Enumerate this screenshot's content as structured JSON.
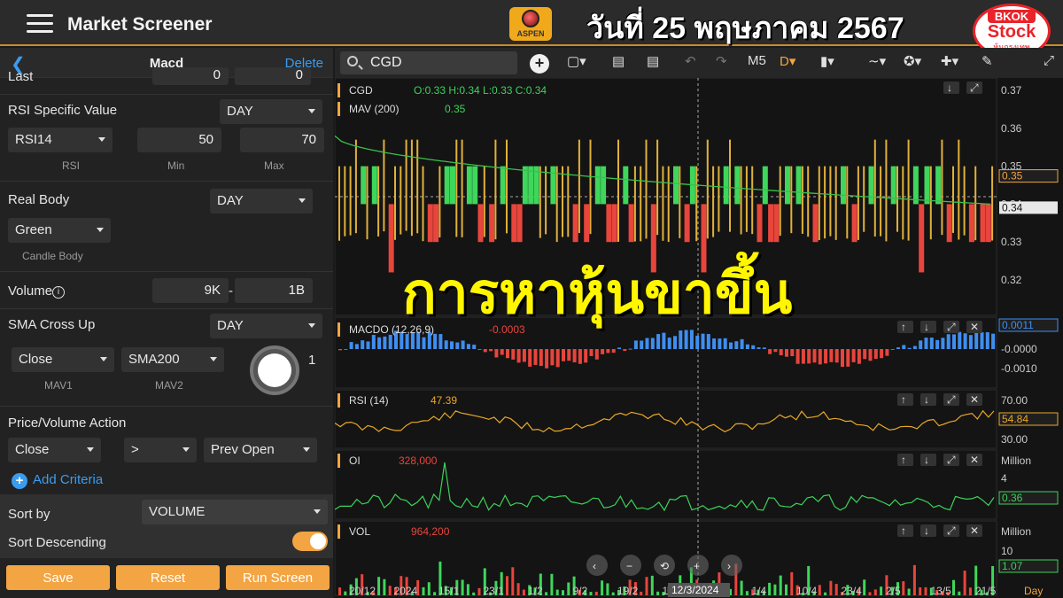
{
  "header": {
    "app_title": "Market Screener",
    "logo_text": "ASPEN",
    "date_banner": "วันที่ 25 พฤษภาคม 2567",
    "badge": {
      "line1": "BKOK",
      "line2": "Stock",
      "line3": "หุ้นกรุงเทพ"
    }
  },
  "panel": {
    "title": "Macd",
    "delete_label": "Delete",
    "last_label": "Last",
    "last_min": "0",
    "last_max": "0",
    "rsi": {
      "label": "RSI Specific Value",
      "period": "DAY",
      "indicator": "RSI14",
      "min": "50",
      "max": "70",
      "sub_rsi": "RSI",
      "sub_min": "Min",
      "sub_max": "Max"
    },
    "real_body": {
      "label": "Real Body",
      "period": "DAY",
      "value": "Green",
      "sub": "Candle Body"
    },
    "volume": {
      "label": "Volume",
      "min": "9K",
      "sep": "-",
      "max": "1B"
    },
    "sma": {
      "label": "SMA Cross Up",
      "period": "DAY",
      "mav1": "Close",
      "mav2": "SMA200",
      "extra": "1",
      "sub_mav1": "MAV1",
      "sub_mav2": "MAV2"
    },
    "pva": {
      "label": "Price/Volume Action",
      "field": "Close",
      "op": ">",
      "target": "Prev Open"
    },
    "add_criteria": "Add Criteria",
    "sort_by_label": "Sort by",
    "sort_by_value": "VOLUME",
    "sort_desc_label": "Sort Descending",
    "buttons": {
      "save": "Save",
      "reset": "Reset",
      "run": "Run Screen"
    }
  },
  "chart_toolbar": {
    "symbol": "CGD",
    "interval": "M5",
    "mode": "D"
  },
  "chart_panels": {
    "price": {
      "name": "CGD",
      "ohlc": "O:0.33 H:0.34 L:0.33 C:0.34",
      "mav_label": "MAV (200)",
      "mav_value": "0.35",
      "y_ticks": [
        "0.37",
        "0.36",
        "0.35",
        "0.34",
        "0.33",
        "0.32"
      ],
      "last_tag": "0.35",
      "cur_tag": "0.34"
    },
    "macd": {
      "label": "MACDO (12,26,9)",
      "value": "-0.0003",
      "y_ticks": [
        "-0.0000",
        "-0.0010"
      ],
      "tag": "0.0011"
    },
    "rsi": {
      "label": "RSI (14)",
      "value": "47.39",
      "y_ticks": [
        "70.00",
        "30.00"
      ],
      "tag": "54.84"
    },
    "oi": {
      "label": "OI",
      "value": "328,000",
      "y_ticks": [
        "Million",
        "4"
      ],
      "tag": "0.36"
    },
    "vol": {
      "label": "VOL",
      "value": "964,200",
      "y_ticks": [
        "Million",
        "10"
      ],
      "tag": "1.07"
    },
    "x_ticks": [
      "20/12",
      "2024",
      "15/1",
      "23/1",
      "1/2",
      "9/2",
      "19/2",
      "1/3",
      "19/3",
      "1/4",
      "10/4",
      "23/4",
      "2/5",
      "13/5",
      "21/5"
    ],
    "x_unit": "Day",
    "cursor_date": "12/3/2024"
  },
  "overlay_caption": "การหาหุ้นขาขึ้น",
  "colors": {
    "accent": "#f2a542",
    "up": "#3ed65b",
    "down": "#e8453c",
    "link": "#3a9cf0",
    "macd_pos": "#3f8ef0",
    "rsi": "#e9a728",
    "caption": "#fff600"
  }
}
